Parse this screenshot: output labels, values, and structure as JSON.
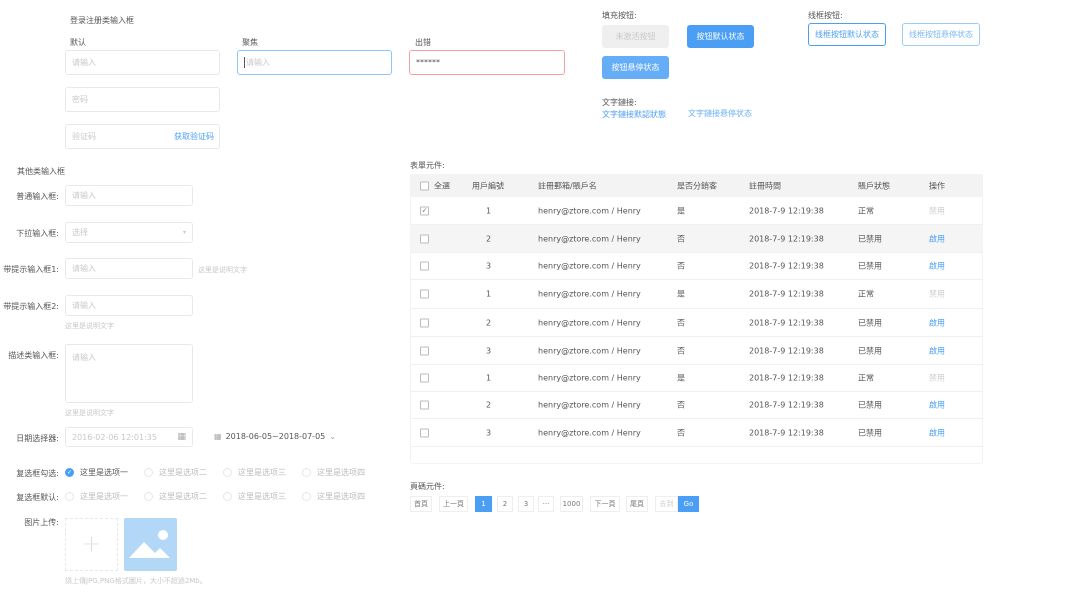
{
  "login": {
    "title": "登录注册类输入框",
    "default_label": "默认",
    "focus_label": "聚焦",
    "error_label": "出错",
    "placeholder": "请输入",
    "error_value": "******",
    "password_placeholder": "密码",
    "code_placeholder": "验证码",
    "get_code": "获取验证码"
  },
  "buttons": {
    "fill_title": "填充按钮:",
    "disabled": "未激活按钮",
    "default": "按钮默认状态",
    "hover": "按钮悬停状态",
    "outline_title": "线框按钮:",
    "outline_default": "线框按钮默认状态",
    "outline_hover": "线框按钮悬停状态",
    "link_title": "文字鏈接:",
    "link_default": "文字鏈接默認狀態",
    "link_hover": "文字鏈接悬停状态"
  },
  "other": {
    "title": "其他类输入框",
    "normal_label": "普通输入框:",
    "select_label": "下拉输入框:",
    "select_placeholder": "选择",
    "hint1_label": "带提示输入框1:",
    "hint2_label": "带提示输入框2:",
    "desc_label": "描述类输入框:",
    "hint_text": "这里是说明文字",
    "placeholder": "请输入"
  },
  "date": {
    "label": "日期选择器:",
    "value": "2016-02-06  12:01:35",
    "range": "2018-06-05~2018-07-05"
  },
  "checks": {
    "checked_label": "复选框勾选:",
    "default_label": "复选框默认:",
    "options": [
      "这里是选项一",
      "这里是选项二",
      "这里是选项三",
      "这里是选项四"
    ]
  },
  "upload": {
    "label": "图片上传:",
    "hint": "請上傳JPG,PNG格式圖片，大小不超過2Mb。"
  },
  "table": {
    "title": "表單元件:",
    "headers": [
      "全選",
      "用戶編號",
      "註冊郵箱/賬戶名",
      "是否分銷客",
      "註冊時間",
      "賬戶狀態",
      "操作"
    ],
    "rows": [
      {
        "checked": true,
        "id": "1",
        "email": "henry@ztore.com / Henry",
        "dist": "是",
        "time": "2018-7-9 12:19:38",
        "status": "正常",
        "op": "禁用",
        "active": false
      },
      {
        "checked": false,
        "id": "2",
        "email": "henry@ztore.com / Henry",
        "dist": "否",
        "time": "2018-7-9 12:19:38",
        "status": "已禁用",
        "op": "啟用",
        "active": true
      },
      {
        "checked": false,
        "id": "3",
        "email": "henry@ztore.com / Henry",
        "dist": "否",
        "time": "2018-7-9 12:19:38",
        "status": "已禁用",
        "op": "啟用",
        "active": true
      },
      {
        "checked": false,
        "id": "1",
        "email": "henry@ztore.com / Henry",
        "dist": "是",
        "time": "2018-7-9 12:19:38",
        "status": "正常",
        "op": "禁用",
        "active": false
      },
      {
        "checked": false,
        "id": "2",
        "email": "henry@ztore.com / Henry",
        "dist": "否",
        "time": "2018-7-9 12:19:38",
        "status": "已禁用",
        "op": "啟用",
        "active": true
      },
      {
        "checked": false,
        "id": "3",
        "email": "henry@ztore.com / Henry",
        "dist": "否",
        "time": "2018-7-9 12:19:38",
        "status": "已禁用",
        "op": "啟用",
        "active": true
      },
      {
        "checked": false,
        "id": "1",
        "email": "henry@ztore.com / Henry",
        "dist": "是",
        "time": "2018-7-9 12:19:38",
        "status": "正常",
        "op": "禁用",
        "active": false
      },
      {
        "checked": false,
        "id": "2",
        "email": "henry@ztore.com / Henry",
        "dist": "否",
        "time": "2018-7-9 12:19:38",
        "status": "已禁用",
        "op": "啟用",
        "active": true
      },
      {
        "checked": false,
        "id": "3",
        "email": "henry@ztore.com / Henry",
        "dist": "否",
        "time": "2018-7-9 12:19:38",
        "status": "已禁用",
        "op": "啟用",
        "active": true
      }
    ]
  },
  "pagination": {
    "title": "頁碼元件:",
    "items": [
      "首頁",
      "上一頁",
      "1",
      "2",
      "3",
      "···",
      "1000",
      "下一頁",
      "尾頁"
    ],
    "current": "1",
    "goto_placeholder": "去到",
    "go": "Go"
  },
  "colors": {
    "primary": "#4a9ff5",
    "error": "#f08080",
    "hover": "#6aaff5"
  }
}
